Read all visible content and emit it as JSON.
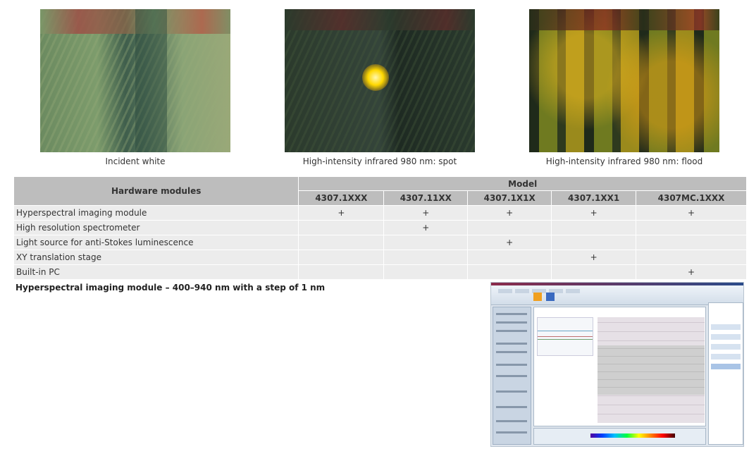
{
  "photos": [
    {
      "caption": "Incident white"
    },
    {
      "caption": "High-intensity infrared 980 nm: spot"
    },
    {
      "caption": "High-intensity infrared 980 nm: flood"
    }
  ],
  "table": {
    "row_header": "Hardware modules",
    "group_header": "Model",
    "columns": [
      "4307.1XXX",
      "4307.11XX",
      "4307.1X1X",
      "4307.1XX1",
      "4307MC.1XXX"
    ],
    "rows": [
      {
        "label": "Hyperspectral imaging module",
        "cells": [
          "+",
          "+",
          "+",
          "+",
          "+"
        ]
      },
      {
        "label": "High resolution spectrometer",
        "cells": [
          "",
          "+",
          "",
          "",
          ""
        ]
      },
      {
        "label": "Light source for anti-Stokes luminescence",
        "cells": [
          "",
          "",
          "+",
          "",
          ""
        ]
      },
      {
        "label": "XY translation stage",
        "cells": [
          "",
          "",
          "",
          "+",
          ""
        ]
      },
      {
        "label": "Built-in PC",
        "cells": [
          "",
          "",
          "",
          "",
          "+"
        ]
      }
    ]
  },
  "section": {
    "title": "Hyperspectral imaging module – 400–940 nm with a step of 1 nm"
  }
}
